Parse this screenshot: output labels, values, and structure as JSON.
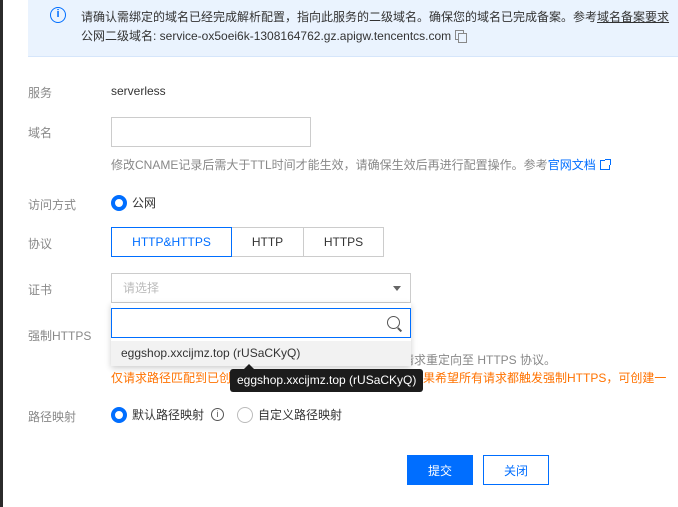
{
  "notice": {
    "text_prefix": "请确认需绑定的域名已经完成解析配置，指向此服务的二级域名。确保您的域名已完成备案。参考",
    "link": "域名备案要求",
    "subdomain_label": "公网二级域名: ",
    "subdomain": "service-ox5oei6k-1308164762.gz.apigw.tencentcs.com"
  },
  "form": {
    "service_label": "服务",
    "service_value": "serverless",
    "domain_label": "域名",
    "domain_value": "",
    "domain_hint": "修改CNAME记录后需大于TTL时间才能生效，请确保生效后再进行配置操作。参考",
    "domain_hint_link": "官网文档",
    "access_label": "访问方式",
    "access_option": "公网",
    "protocol_label": "协议",
    "protocols": [
      "HTTP&HTTPS",
      "HTTP",
      "HTTPS"
    ],
    "cert_label": "证书",
    "cert_placeholder": "请选择",
    "cert_search_value": "",
    "cert_option": "eggshop.xxcijmz.top (rUSaCKyQ)",
    "tooltip": "eggshop.xxcijmz.top (rUSaCKyQ)",
    "force_https_label": "强制HTTPS",
    "force_https_hint": "请求重定向至 HTTPS 协议。",
    "orange_prefix": "仅请求路径匹配到已创",
    "orange_suffix": "如果希望所有请求都触发强制HTTPS，可创建一",
    "path_label": "路径映射",
    "path_default": "默认路径映射",
    "path_custom": "自定义路径映射"
  },
  "buttons": {
    "submit": "提交",
    "close": "关闭"
  },
  "colors": {
    "accent": "#006eff",
    "warning": "#ff7200",
    "notice_bg": "#eaf3fe"
  }
}
